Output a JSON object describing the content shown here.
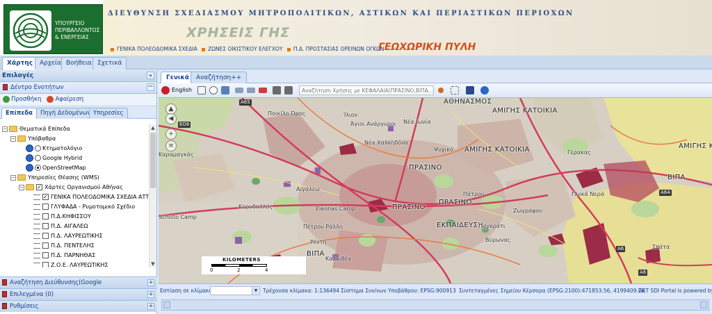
{
  "banner": {
    "ministry_lines": [
      "ΥΠΟΥΡΓΕΙΟ",
      "ΠΕΡΙΒΑΛΛΟΝΤΟΣ",
      "& ΕΝΕΡΓΕΙΑΣ"
    ],
    "directorate": "ΔΙΕΥΘΥΝΣΗ ΣΧΕΔΙΑΣΜΟΥ ΜΗΤΡΟΠΟΛΙΤΙΚΩΝ, ΑΣΤΙΚΩΝ ΚΑΙ ΠΕΡΙΑΣΤΙΚΩΝ ΠΕΡΙΟΧΩΝ",
    "land_uses": "ΧΡΗΣΕΙΣ ΓΗΣ",
    "links": [
      "ΓΕΝΙΚΑ ΠΟΛΕΟΔΟΜΙΚΑ ΣΧΕΔΙΑ",
      "ΖΩΝΕΣ ΟΙΚΙΣΤΙΚΟΥ ΕΛΕΓΧΟΥ",
      "Π.Δ. ΠΡΟΣΤΑΣΙΑΣ ΟΡΕΙΝΩΝ ΟΓΚΩΝ"
    ],
    "geo_portal": "ΓΕΩΧΩΡΙΚΗ ΠΥΛΗ"
  },
  "top_tabs": [
    "Χάρτης",
    "Αρχεία",
    "Βοήθεια",
    "Σχετικά"
  ],
  "left": {
    "header": "Επιλογές",
    "tree_panel": "Δέντρο Ενοτήτων",
    "add_label": "Προσθήκη",
    "remove_label": "Αφαίρεση",
    "tabs": [
      "Επίπεδα",
      "Πηγή Δεδομένων",
      "Υπηρεσίες"
    ],
    "tree": {
      "thematic": "Θεματικά Επίπεδα",
      "base": "Υπόβαθρα",
      "cadastre": "Κτηματολόγιο",
      "google": "Google Hybrid",
      "osm": "OpenStreetMap",
      "wms": "Υπηρεσίες Θέασης (WMS)",
      "athens_org": "Χάρτες Οργανισμού Αθήνας",
      "layers": [
        "ΓΕΝΙΚΑ ΠΟΛΕΟΔΟΜΙΚΑ ΣΧΕΔΙΑ ΑΤΤΙΚ",
        "ΓΛΥΦΑΔΑ - Ρυμοτομικό Σχέδιο",
        "Π.Δ.ΚΗΦΙΣΣΟΥ",
        "Π.Δ. ΑΙΓΑΛΕΩ",
        "Π.Δ. ΛΑΥΡΕΩΤΙΚΗΣ",
        "Π.Δ. ΠΕΝΤΕΛΗΣ",
        "Π.Δ. ΠΑΡΝΗΘΑΣ",
        "Ζ.Ο.Ε. ΛΑΥΡΕΩΤΙΚΗΣ"
      ]
    },
    "bottom_panels": [
      "Αναζήτηση Διεύθυνσης(Google Γεωκωδικοποίηση)",
      "Επιλεγμένα (0)",
      "Ρυθμίσεις"
    ]
  },
  "map_tabs": [
    "Γενικά",
    "Αναζήτηση++"
  ],
  "toolbar": {
    "language": "English",
    "search_placeholder": "Αναζήτηση Χρήσης με ΚΕΦΑΛΑΙΑ(ΠΡΑΣΙΝΟ,ΒΙΠΑ...)"
  },
  "map": {
    "labels": [
      "ΑΘΗΝΑΣΜΟΣ",
      "ΑΜΙΓΗΣ ΚΑΤΟΙΚΙΑ",
      "ΑΜΙΓΗΣ ΚΑΤΟΙΚΙΑ",
      "ΑΜΙΓΗΣ ΚΑΤΟΙ",
      "ΠΡΑΣΙΝΟ",
      "ΠΡΑΣΙΝΟ",
      "ΠΡΑΣΙΝΟ",
      "ΕΚΠΑΙΔΕΥΣΗ",
      "ΒΙΠΑ",
      "ΒΙΠΑ",
      "Ποικίλο Όρος",
      "Ίλιον",
      "Άγιοι Ανάργυροι",
      "Νέα Χαλκηδόνα",
      "Νέα Ιωνία",
      "Ψυχικό",
      "Γέρακας",
      "Καραμαγκάς",
      "Eleonas Camp",
      "Schisto Camp",
      "Πέτρου Ράλλη",
      "Ρέντη",
      "Καλλιθέα",
      "Παγκράτι",
      "Βύρωνας",
      "Ζωγράφου",
      "Αιγάλεω",
      "Κορυδαλλός",
      "Πάτρου",
      "Σπάτα",
      "Γλυκά Νερά"
    ],
    "shields": [
      "A65",
      "EO8",
      "A64",
      "A6",
      "A6"
    ],
    "scale_title": "KILOMETERS",
    "scale_ticks": [
      "0",
      "2",
      "4"
    ]
  },
  "status": {
    "focus_label": "Εστίαση σε κλίμακα:",
    "current_scale": "Τρέχουσα κλίμακα: 1:136494",
    "crs": "Σύστημα Συν/νων Υποβάθρου: EPSG:900913",
    "coords": "Συντεταγμένες Σημείου Κέρσορα (EPSG:2100):471853.56, 4199409.26",
    "powered": "GET SDI Portal is powered by"
  },
  "colors": {
    "panel_bg": "#dfe8f6",
    "accent": "#15428b",
    "logo_green": "#1b6e2e",
    "portal_orange": "#d2501b"
  }
}
